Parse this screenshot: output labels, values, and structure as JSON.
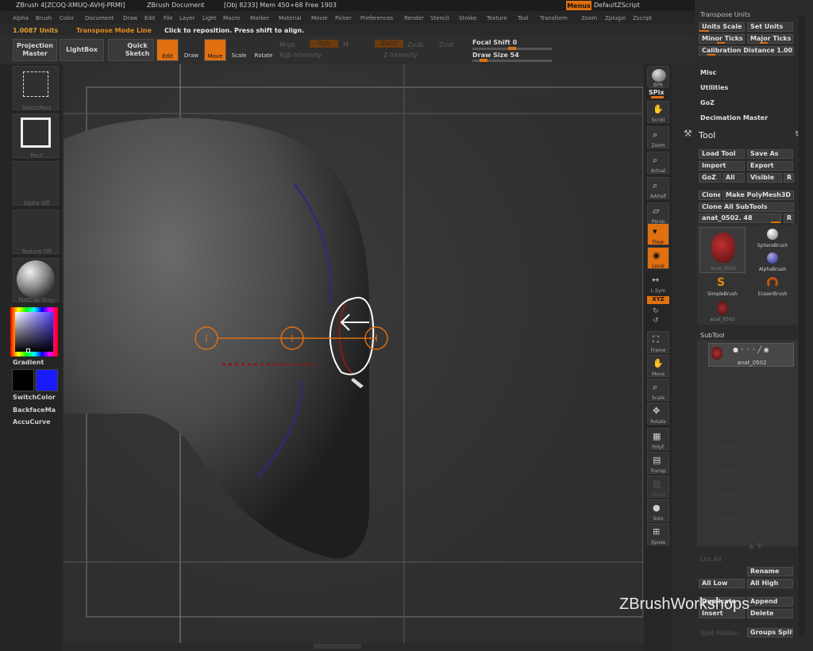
{
  "titlebar": {
    "app": "ZBrush 4[ZCOQ-XMUQ-AVHJ-PRMI]",
    "doc": "ZBrush Document",
    "stats": "[Obj 8233] Mem 450+68 Free 1903",
    "menus_btn": "Menus",
    "script_btn": "DefaultZScript"
  },
  "menubar": [
    "Alpha",
    "Brush",
    "Color",
    "Document",
    "Draw",
    "Edit",
    "File",
    "Layer",
    "Light",
    "Macro",
    "Marker",
    "Material",
    "Movie",
    "Picker",
    "Preferences",
    "Render",
    "Stencil",
    "Stroke",
    "Texture",
    "Tool",
    "Transform",
    "Zoom",
    "Zplugin",
    "Zscript"
  ],
  "infobar": {
    "units": "1.0087 Units",
    "mode": "Transpose Mode Line",
    "hint": "Click to reposition. Press shift to align."
  },
  "toolbar": {
    "projection_master": "Projection Master",
    "lightbox": "LightBox",
    "quick_sketch": "Quick Sketch",
    "edit": "Edit",
    "draw": "Draw",
    "move": "Move",
    "scale": "Scale",
    "rotate": "Rotate",
    "mrgb": "Mrgb",
    "rgb": "Rgb",
    "m": "M",
    "zadd": "Zadd",
    "zsub": "Zsub",
    "zcut": "Zcut",
    "rgb_intensity": "Rgb Intensity",
    "z_intensity": "Z Intensity",
    "focal_shift_label": "Focal Shift",
    "focal_shift_value": "0",
    "draw_size_label": "Draw Size",
    "draw_size_value": "54",
    "focal_shift_level": 0.5,
    "draw_size_level": 0.1
  },
  "leftshelf": {
    "selectrect": "SelectRect",
    "rect": "Rect",
    "alpha": "Alpha Off",
    "texture": "Texture Off",
    "material": "MatCap Gray",
    "gradient": "Gradient",
    "switchcolor": "SwitchColor",
    "backface": "BackfaceMa",
    "accucurve": "AccuCurve",
    "color_main": "#000000",
    "color_secondary": "#1a1aff"
  },
  "rightshelf": {
    "bpr": "BPR",
    "spix": "SPix",
    "scroll": "Scroll",
    "zoom": "Zoom",
    "actual": "Actual",
    "aahalf": "AAHalf",
    "persp": "Persp",
    "floor": "Floor",
    "local": "Local",
    "lsym": "L.Sym",
    "xyz": "XYZ",
    "frame": "Frame",
    "move": "Move",
    "scale": "Scale",
    "rotate": "Rotate",
    "polyf": "PolyF",
    "transp": "Transp",
    "ghost": "Ghost",
    "solo": "Solo",
    "xpose": "Xpose"
  },
  "panel": {
    "transpose_units": "Transpose Units",
    "units_scale": "Units Scale",
    "set_units": "Set Units",
    "minor_ticks": "Minor Ticks",
    "major_ticks": "Major Ticks",
    "calibration_distance": "Calibration Distance 1.00",
    "misc": "Misc",
    "utilities": "Utilities",
    "goz_header": "GoZ",
    "decimation": "Decimation Master",
    "tool_title": "Tool",
    "load_tool": "Load Tool",
    "save_as": "Save As",
    "import": "Import",
    "export": "Export",
    "goz": "GoZ",
    "all": "All",
    "visible": "Visible",
    "r": "R",
    "clone": "Clone",
    "make_polymesh": "Make PolyMesh3D",
    "clone_all": "Clone All SubTools",
    "current_tool": "anat_0502. 48",
    "tools": [
      "anat_0502",
      "SphereBrush",
      "AlphaBrush",
      "SimpleBrush",
      "EraserBrush",
      "anat_0502"
    ],
    "subtool_header": "SubTool",
    "subtool_item": "anat_0502",
    "subtool_empty": [
      "Subtool 1",
      "Subtool 2",
      "Subtool 3",
      "Subtool 4",
      "Subtool 5",
      "Subtool 6",
      "Subtool 7"
    ],
    "list_all": "List All",
    "rename": "Rename",
    "all_low": "All Low",
    "all_high": "All High",
    "duplicate": "Duplicate",
    "append": "Append",
    "insert": "Insert",
    "delete": "Delete",
    "split_hidden": "Split Hidden",
    "groups_split": "Groups Split"
  },
  "watermark": "ZBrushWorkshops",
  "accent": "#e07010"
}
